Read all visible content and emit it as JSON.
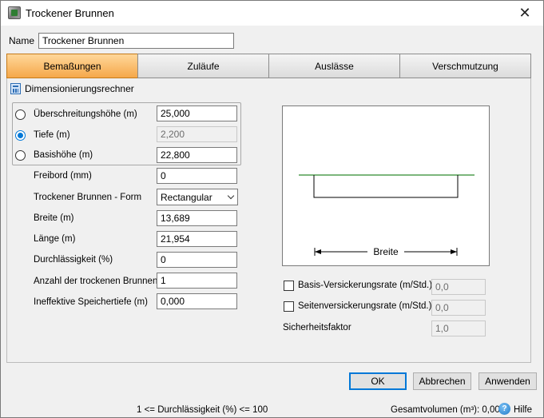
{
  "window": {
    "title": "Trockener Brunnen",
    "close_glyph": "✕"
  },
  "name_field": {
    "label": "Name",
    "value": "Trockener Brunnen"
  },
  "tabs": [
    {
      "label": "Bemaßungen",
      "active": true
    },
    {
      "label": "Zuläufe",
      "active": false
    },
    {
      "label": "Auslässe",
      "active": false
    },
    {
      "label": "Verschmutzung",
      "active": false
    }
  ],
  "calculator": {
    "title": "Dimensionierungsrechner",
    "options": [
      {
        "label": "Überschreitungshöhe (m)",
        "value": "25,000",
        "selected": false,
        "enabled": true
      },
      {
        "label": "Tiefe (m)",
        "value": "2,200",
        "selected": true,
        "enabled": false
      },
      {
        "label": "Basishöhe (m)",
        "value": "22,800",
        "selected": false,
        "enabled": true
      }
    ]
  },
  "fields": {
    "freibord": {
      "label": "Freibord (mm)",
      "value": "0"
    },
    "form": {
      "label": "Trockener Brunnen - Form",
      "value": "Rectangular"
    },
    "breite": {
      "label": "Breite (m)",
      "value": "13,689"
    },
    "laenge": {
      "label": "Länge (m)",
      "value": "21,954"
    },
    "durchlaessigkeit": {
      "label": "Durchlässigkeit (%)",
      "value": "0"
    },
    "anzahl": {
      "label": "Anzahl der trockenen Brunnen",
      "value": "1"
    },
    "ineffektiv": {
      "label": "Ineffektive Speichertiefe (m)",
      "value": "0,000"
    }
  },
  "diagram": {
    "dimension_label": "Breite",
    "waterline_color": "#2e8b2e"
  },
  "infiltration": {
    "basis": {
      "label": "Basis-Versickerungsrate (m/Std.)",
      "value": "0,0",
      "checked": false
    },
    "seiten": {
      "label": "Seitenversickerungsrate (m/Std.)",
      "value": "0,0",
      "checked": false
    },
    "sicherheit": {
      "label": "Sicherheitsfaktor",
      "value": "1,0"
    }
  },
  "buttons": {
    "ok": "OK",
    "cancel": "Abbrechen",
    "apply": "Anwenden"
  },
  "status": {
    "hint": "1 <= Durchlässigkeit (%) <= 100",
    "volume": "Gesamtvolumen (m³): 0,000",
    "help_glyph": "?",
    "help": "Hilfe"
  },
  "colors": {
    "active_tab": "#f5a84a",
    "accent": "#0078d7"
  }
}
